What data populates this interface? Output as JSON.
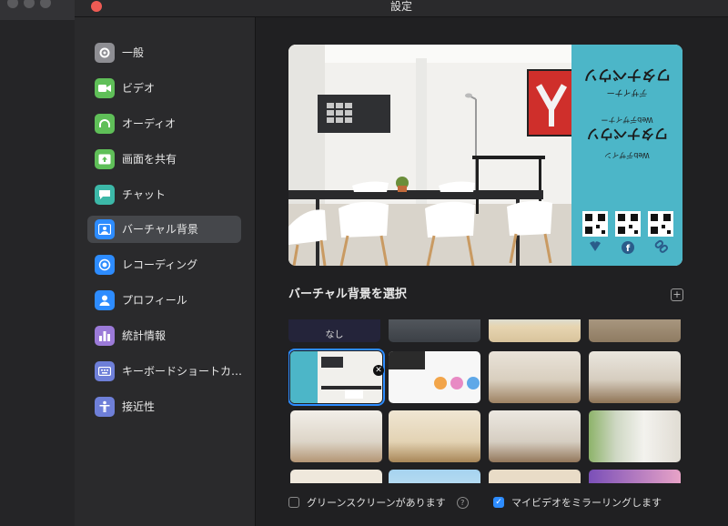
{
  "window": {
    "title": "設定"
  },
  "sidebar": {
    "items": [
      {
        "label": "一般",
        "icon": "gear-icon",
        "color": "#8e8e93"
      },
      {
        "label": "ビデオ",
        "icon": "video-camera-icon",
        "color": "#5fbf58"
      },
      {
        "label": "オーディオ",
        "icon": "headphones-icon",
        "color": "#5fbf58"
      },
      {
        "label": "画面を共有",
        "icon": "share-screen-icon",
        "color": "#5fbf58"
      },
      {
        "label": "チャット",
        "icon": "chat-bubble-icon",
        "color": "#3cb8a8"
      },
      {
        "label": "バーチャル背景",
        "icon": "person-background-icon",
        "color": "#2d8cff",
        "selected": true
      },
      {
        "label": "レコーディング",
        "icon": "record-icon",
        "color": "#2d8cff"
      },
      {
        "label": "プロフィール",
        "icon": "person-icon",
        "color": "#2d8cff"
      },
      {
        "label": "統計情報",
        "icon": "bar-chart-icon",
        "color": "#9b7ad8"
      },
      {
        "label": "キーボードショートカ…",
        "icon": "keyboard-icon",
        "color": "#6e7fd8"
      },
      {
        "label": "接近性",
        "icon": "accessibility-icon",
        "color": "#6e7fd8"
      }
    ]
  },
  "preview": {
    "banner": {
      "logo_text": "ワタナベウソ",
      "tagline": "Webデザイナー",
      "social_icons": [
        "heart-icon",
        "facebook-icon",
        "link-icon"
      ]
    }
  },
  "main": {
    "section_title": "バーチャル背景を選択",
    "add_button": "+",
    "none_label": "なし",
    "thumbnails_selected_index": 4
  },
  "options": {
    "green_screen": {
      "label": "グリーンスクリーンがあります",
      "checked": false,
      "help": "?"
    },
    "mirror": {
      "label": "マイビデオをミラーリングします",
      "checked": true
    }
  },
  "colors": {
    "accent": "#2d8cff",
    "banner": "#4cb6c8"
  }
}
